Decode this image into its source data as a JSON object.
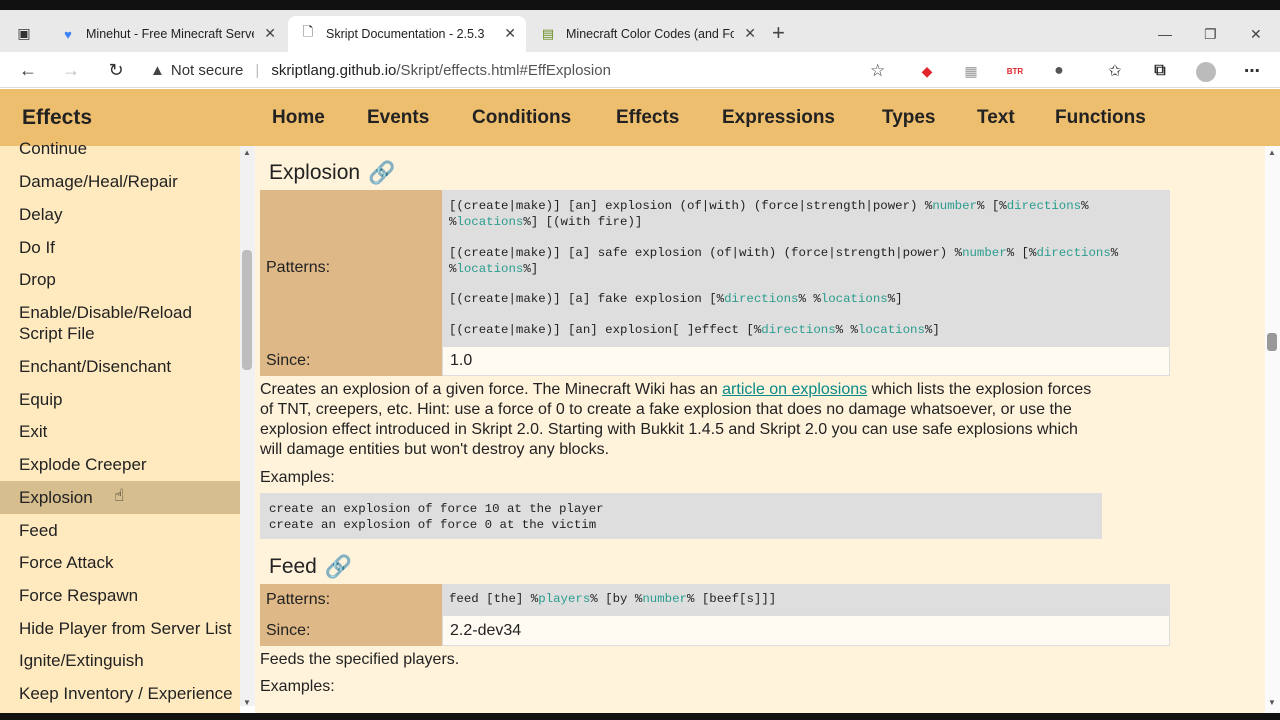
{
  "browser": {
    "tabs": [
      {
        "title": "Minehut - Free Minecraft Server",
        "icon": "minehut-icon"
      },
      {
        "title": "Skript Documentation - 2.5.3",
        "icon": "document-icon"
      },
      {
        "title": "Minecraft Color Codes (and Form",
        "icon": "sheet-icon"
      }
    ],
    "security_label": "Not secure",
    "url_host": "skriptlang.github.io",
    "url_path": "/Skript/effects.html#EffExplosion",
    "extensions": [
      {
        "name": "roblox-ext-icon",
        "text": "R",
        "color": "#e0252c"
      },
      {
        "name": "grid-ext-icon",
        "text": "▦",
        "color": "#999999"
      },
      {
        "name": "btr-ext-icon",
        "text": "BTR",
        "color": "#e0252c"
      },
      {
        "name": "chat-ext-icon",
        "text": "●",
        "color": "#555555"
      }
    ]
  },
  "sidebar": {
    "title": "Effects",
    "items": [
      "Continue",
      "Damage/Heal/Repair",
      "Delay",
      "Do If",
      "Drop",
      "Enable/Disable/Reload\nScript File",
      "Enchant/Disenchant",
      "Equip",
      "Exit",
      "Explode Creeper",
      "Explosion",
      "Feed",
      "Force Attack",
      "Force Respawn",
      "Hide Player from Server List",
      "Ignite/Extinguish",
      "Keep Inventory / Experience"
    ],
    "selected": "Explosion"
  },
  "nav": [
    "Home",
    "Events",
    "Conditions",
    "Effects",
    "Expressions",
    "Types",
    "Text",
    "Functions"
  ],
  "sections": [
    {
      "title": "Explosion",
      "patterns_label": "Patterns:",
      "since_label": "Since:",
      "since": "1.0",
      "pattern_lines": [
        "[(create|make)] [an] explosion (of|with) (force|strength|power) %number% [%directions%",
        "%locations%] [(with fire)]",
        "[(create|make)] [a] safe explosion (of|with) (force|strength|power) %number% [%directions%",
        "%locations%]",
        "[(create|make)] [a] fake explosion [%directions% %locations%]",
        "[(create|make)] [an] explosion[ ]effect [%directions% %locations%]"
      ],
      "desc_before": "Creates an explosion of a given force. The Minecraft Wiki has an ",
      "desc_link": "article on explosions",
      "desc_after": " which lists the explosion forces of TNT, creepers, etc. Hint: use a force of 0 to create a fake explosion that does no damage whatsoever, or use the explosion effect introduced in Skript 2.0. Starting with Bukkit 1.4.5 and Skript 2.0 you can use safe explosions which will damage entities but won't destroy any blocks.",
      "examples_label": "Examples:",
      "examples": "create an explosion of force 10 at the player\ncreate an explosion of force 0 at the victim"
    },
    {
      "title": "Feed",
      "patterns_label": "Patterns:",
      "since_label": "Since:",
      "since": "2.2-dev34",
      "pattern_lines": [
        "feed [the] %players% [by %number% [beef[s]]]"
      ],
      "desc": "Feeds the specified players.",
      "examples_label": "Examples:"
    }
  ]
}
